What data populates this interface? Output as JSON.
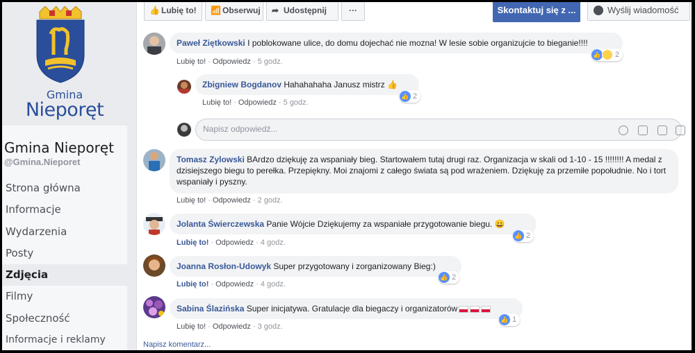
{
  "sidebar": {
    "logo_top": "Gmina",
    "logo_bottom": "Nieporęt",
    "page_name": "Gmina Nieporęt",
    "handle": "@Gmina.Nieporet",
    "items": [
      {
        "label": "Strona główna"
      },
      {
        "label": "Informacje"
      },
      {
        "label": "Wydarzenia"
      },
      {
        "label": "Posty"
      },
      {
        "label": "Zdjęcia"
      },
      {
        "label": "Filmy"
      },
      {
        "label": "Społeczność"
      },
      {
        "label": "Informacje i reklamy"
      }
    ]
  },
  "topbar": {
    "like": "Lubię to!",
    "follow": "Obserwuj",
    "share": "Udostępnij",
    "more": "···",
    "contact": "Skontaktuj się z ...",
    "message": "Wyślij wiadomość"
  },
  "comments": [
    {
      "author": "Paweł Ziętkowski",
      "text": "I poblokowane ulice, do domu dojechać nie mozna! W lesie sobie organizujcie to bieganie!!!!",
      "like": "Lubię to!",
      "reply": "Odpowiedz",
      "time": "5 godz.",
      "reactions": "2"
    },
    {
      "author": "Zbigniew Bogdanov",
      "text": "Hahahahaha Janusz mistrz 👍",
      "like": "Lubię to!",
      "reply": "Odpowiedz",
      "time": "5 godz.",
      "reactions": "2"
    },
    {
      "author": "Tomasz Zylowski",
      "text": "BArdzo dziękuję za wspaniały bieg. Startowałem tutaj drugi raz. Organizacja w skali od 1-10 - 15 !!!!!!!! A medal z dzisiejszego biegu to perełka. Przepiękny. Moi znajomi z całego świata są pod wrażeniem. Dzięk​uję za przemiłe popołudnie. No i tort wspaniały i pyszny.",
      "like": "Lubię to!",
      "reply": "Odpowiedz",
      "time": "2 godz."
    },
    {
      "author": "Jolanta Świerczewska",
      "text": "Panie Wójcie Dziękujemy za wspaniałe przygotowanie biegu. 😄",
      "like": "Lubię to!",
      "reply": "Odpowiedz",
      "time": "4 godz.",
      "reactions": "2"
    },
    {
      "author": "Joanna Rosłon-Udowyk",
      "text": "Super przygotowany i zorganizowany Bieg:)",
      "like": "Lubię to!",
      "reply": "Odpowiedz",
      "time": "4 godz.",
      "reactions": "2"
    },
    {
      "author": "Sabina Ślazińska",
      "text": "Super inicjatywa. Gratulacje dla biegaczy i organizatorów",
      "like": "Lubię to!",
      "reply": "Odpowiedz",
      "time": "3 godz.",
      "reactions": "1"
    }
  ],
  "reply_placeholder": "Napisz odpowiedź...",
  "write_comment": "Napisz komentarz..."
}
